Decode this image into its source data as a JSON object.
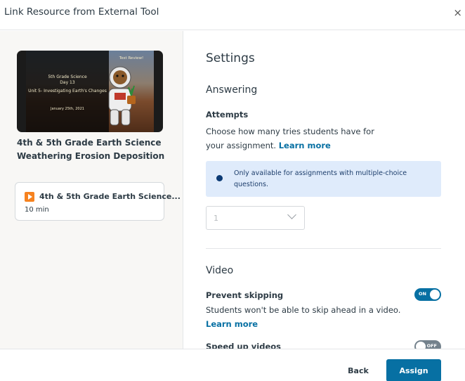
{
  "dialog": {
    "title": "Link Resource from External Tool",
    "close_label": "×"
  },
  "resource": {
    "thumbnail": {
      "badge": "Test Review!",
      "line1": "5th Grade Science",
      "line2": "Day 13",
      "line3": "Unit 5- Investigating Earth's Changes",
      "date": "January 25th, 2021"
    },
    "title": "4th & 5th Grade Earth Science Weathering Erosion Deposition",
    "card_title": "4th & 5th Grade Earth Science...",
    "card_duration": "10 min"
  },
  "settings": {
    "heading": "Settings",
    "answering": {
      "heading": "Answering",
      "attempts_label": "Attempts",
      "attempts_desc": "Choose how many tries students have for your assignment.",
      "learn_more": "Learn more",
      "info_text": "Only available for assignments with multiple-choice questions.",
      "attempts_value": "1"
    },
    "video": {
      "heading": "Video",
      "prevent_skipping_label": "Prevent skipping",
      "prevent_skipping_state": "ON",
      "prevent_skipping_desc": "Students won't be able to skip ahead in a video.",
      "learn_more": "Learn more",
      "speed_up_label": "Speed up videos",
      "speed_up_state": "OFF"
    }
  },
  "footer": {
    "back_label": "Back",
    "assign_label": "Assign"
  },
  "colors": {
    "accent": "#0770a3",
    "info_bg": "#dfebfb",
    "play_icon": "#f6821f"
  }
}
